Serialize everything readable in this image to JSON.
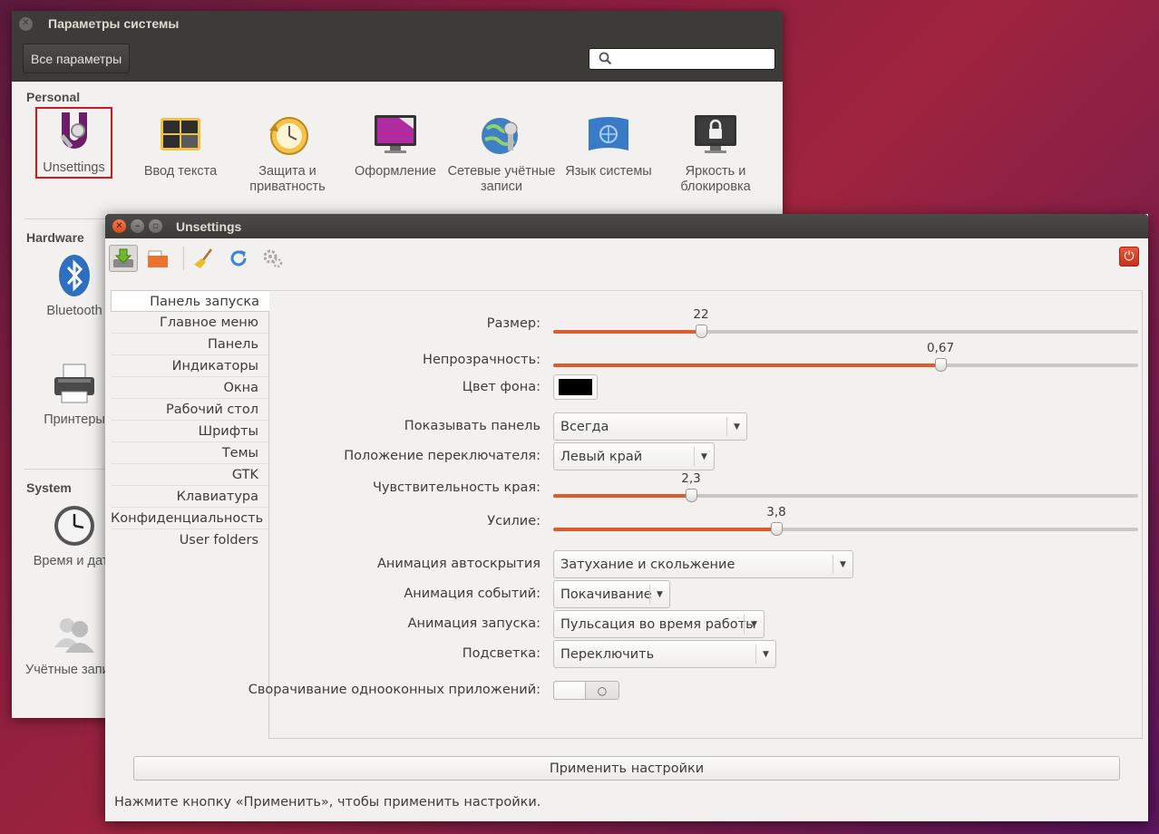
{
  "system_settings": {
    "title": "Параметры системы",
    "all_settings_label": "Все параметры",
    "sections": {
      "personal": "Personal",
      "hardware": "Hardware",
      "system": "System"
    },
    "personal_items": [
      {
        "label": "Unsettings",
        "icon": "unsettings-icon"
      },
      {
        "label": "Ввод текста",
        "icon": "keyboard-layout-icon"
      },
      {
        "label": "Защита и приватность",
        "icon": "privacy-clock-icon"
      },
      {
        "label": "Оформление",
        "icon": "appearance-monitor-icon"
      },
      {
        "label": "Сетевые учётные записи",
        "icon": "online-accounts-icon"
      },
      {
        "label": "Язык системы",
        "icon": "language-flag-icon"
      },
      {
        "label": "Яркость и блокировка",
        "icon": "lock-screen-icon"
      }
    ],
    "hardware_items": [
      {
        "label": "Bluetooth",
        "icon": "bluetooth-icon"
      },
      {
        "label": "Принтеры",
        "icon": "printer-icon"
      }
    ],
    "system_items": [
      {
        "label": "Время и дата",
        "icon": "clock-icon"
      },
      {
        "label": "Учётные записи",
        "icon": "users-icon"
      }
    ]
  },
  "unsettings": {
    "title": "Unsettings",
    "toolbar_icons": [
      "save-icon",
      "open-folder-icon",
      "broom-icon",
      "refresh-icon",
      "gears-icon",
      "power-icon"
    ],
    "nav": [
      "Панель запуска",
      "Главное меню",
      "Панель",
      "Индикаторы",
      "Окна",
      "Рабочий стол",
      "Шрифты",
      "Темы",
      "GTK",
      "Клавиатура",
      "Конфиденциальность",
      "User folders"
    ],
    "settings": {
      "size": {
        "label": "Размер:",
        "value": "22",
        "fraction": 0.253
      },
      "opacity": {
        "label": "Непрозрачность:",
        "value": "0,67",
        "fraction": 0.662
      },
      "bg_color": {
        "label": "Цвет фона:",
        "color": "#000000"
      },
      "show_panel": {
        "label": "Показывать панель",
        "value": "Всегда"
      },
      "switcher_position": {
        "label": "Положение переключателя:",
        "value": "Левый край"
      },
      "edge_sensitivity": {
        "label": "Чувствительность края:",
        "value": "2,3",
        "fraction": 0.235
      },
      "pressure": {
        "label": "Усилие:",
        "value": "3,8",
        "fraction": 0.381
      },
      "autohide_animation": {
        "label": "Анимация автоскрытия",
        "value": "Затухание и скольжение"
      },
      "urgent_animation": {
        "label": "Анимация событий:",
        "value": "Покачивание"
      },
      "launch_animation": {
        "label": "Анимация запуска:",
        "value": "Пульсация во время работы"
      },
      "backlight": {
        "label": "Подсветка:",
        "value": "Переключить"
      },
      "minimize_single": {
        "label": "Сворачивание однооконных приложений:",
        "state": "off"
      }
    },
    "apply_label": "Применить настройки",
    "status": "Нажмите кнопку «Применить», чтобы применить настройки.",
    "accent_color": "#dd5c2e"
  }
}
